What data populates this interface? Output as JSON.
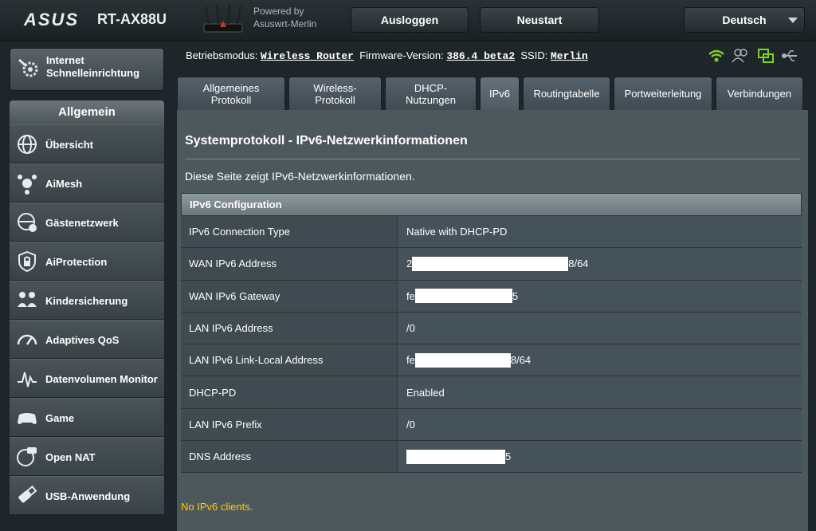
{
  "header": {
    "brand": "ASUS",
    "model": "RT-AX88U",
    "powered_by_line1": "Powered by",
    "powered_by_line2": "Asuswrt-Merlin",
    "logout_label": "Ausloggen",
    "restart_label": "Neustart",
    "language": "Deutsch"
  },
  "quick_setup": {
    "label_line1": "Internet",
    "label_line2": "Schnelleinrichtung",
    "icon": "wand-gear-icon"
  },
  "sidebar": {
    "section_title": "Allgemein",
    "items": [
      {
        "label": "Übersicht",
        "icon": "globe-icon"
      },
      {
        "label": "AiMesh",
        "icon": "mesh-icon"
      },
      {
        "label": "Gästenetzwerk",
        "icon": "guest-network-icon"
      },
      {
        "label": "AiProtection",
        "icon": "shield-lock-icon"
      },
      {
        "label": "Kindersicherung",
        "icon": "family-icon"
      },
      {
        "label": "Adaptives QoS",
        "icon": "speedometer-icon"
      },
      {
        "label": "Datenvolumen Monitor",
        "icon": "traffic-monitor-icon"
      },
      {
        "label": "Game",
        "icon": "gamepad-icon"
      },
      {
        "label": "Open NAT",
        "icon": "open-nat-icon"
      },
      {
        "label": "USB-Anwendung",
        "icon": "usb-icon"
      }
    ]
  },
  "status_bar": {
    "mode_label": "Betriebsmodus:",
    "mode_value": "Wireless Router",
    "firmware_label": "Firmware-Version:",
    "firmware_value": "386.4_beta2",
    "ssid_label": "SSID:",
    "ssid_value": "Merlin",
    "icons": [
      "wifi-icon",
      "users-icon",
      "network-icon",
      "usb-icon"
    ],
    "wifi_color": "#7ed321",
    "network_color": "#7ed321"
  },
  "tabs": [
    {
      "label": "Allgemeines Protokoll"
    },
    {
      "label": "Wireless-Protokoll"
    },
    {
      "label": "DHCP-Nutzungen"
    },
    {
      "label": "IPv6",
      "active": true
    },
    {
      "label": "Routingtabelle"
    },
    {
      "label": "Portweiterleitung"
    },
    {
      "label": "Verbindungen"
    }
  ],
  "content": {
    "title": "Systemprotokoll - IPv6-Netzwerkinformationen",
    "description": "Diese Seite zeigt IPv6-Netzwerkinformationen.",
    "table_title": "IPv6 Configuration",
    "rows": [
      {
        "key": "IPv6 Connection Type",
        "prefix": "Native with DHCP-PD",
        "suffix": ""
      },
      {
        "key": "WAN IPv6 Address",
        "prefix": "2",
        "suffix": "8/64",
        "redacted": true
      },
      {
        "key": "WAN IPv6 Gateway",
        "prefix": "fe",
        "suffix": "5",
        "redacted": true
      },
      {
        "key": "LAN IPv6 Address",
        "prefix": "/0",
        "suffix": ""
      },
      {
        "key": "LAN IPv6 Link-Local Address",
        "prefix": "fe",
        "suffix": "8/64",
        "redacted": true
      },
      {
        "key": "DHCP-PD",
        "prefix": "Enabled",
        "suffix": ""
      },
      {
        "key": "LAN IPv6 Prefix",
        "prefix": "/0",
        "suffix": ""
      },
      {
        "key": "DNS Address",
        "prefix": "",
        "suffix": "5",
        "redacted": true
      }
    ],
    "no_clients": "No IPv6 clients.",
    "warning_color": "#ffcc00"
  }
}
